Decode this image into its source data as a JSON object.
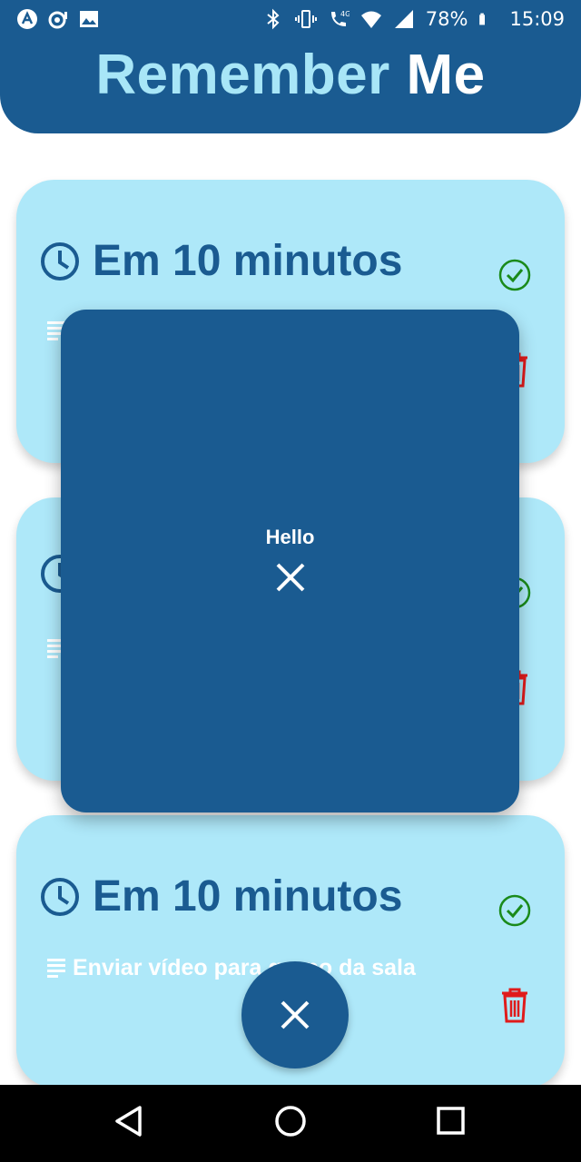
{
  "status_bar": {
    "battery": "78%",
    "time": "15:09",
    "icons_left": [
      "app-icon",
      "notification-icon",
      "image-icon"
    ],
    "icons_right": [
      "bluetooth-icon",
      "vibrate-icon",
      "call-4g-icon",
      "wifi-icon",
      "signal-icon",
      "battery-icon"
    ]
  },
  "header": {
    "title_part1": "Remember",
    "title_part2": "Me"
  },
  "cards": [
    {
      "time": "Em 10 minutos",
      "description": ""
    },
    {
      "time": "",
      "description": ""
    },
    {
      "time": "Em 10 minutos",
      "description": "Enviar vídeo para grupo da sala"
    }
  ],
  "modal": {
    "text": "Hello",
    "close_icon": "close-icon"
  },
  "fab": {
    "icon": "close-icon"
  },
  "nav": {
    "icons": [
      "back-icon",
      "home-icon",
      "recents-icon"
    ]
  },
  "colors": {
    "primary": "#1a5b91",
    "card_bg": "#aee8f9",
    "title_accent": "#a8e6f7",
    "check": "#1a8a1a",
    "trash": "#e01b1b"
  }
}
